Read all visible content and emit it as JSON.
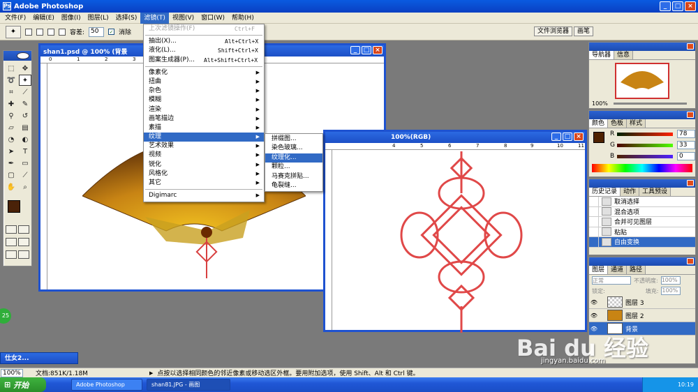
{
  "app": {
    "title": "Adobe Photoshop"
  },
  "menubar": [
    {
      "label": "文件(F)"
    },
    {
      "label": "编辑(E)"
    },
    {
      "label": "图像(I)"
    },
    {
      "label": "图层(L)"
    },
    {
      "label": "选择(S)"
    },
    {
      "label": "滤镜(T)"
    },
    {
      "label": "视图(V)"
    },
    {
      "label": "窗口(W)"
    },
    {
      "label": "帮助(H)"
    }
  ],
  "options": {
    "tolerance_label": "容差:",
    "tolerance_value": "50",
    "antialias_label": "消除"
  },
  "palette_well": [
    "文件浏览器",
    "画笔"
  ],
  "doc1": {
    "title": "shan1.psd @ 100% (背景",
    "ruler": [
      "0",
      "1",
      "2",
      "3",
      "4",
      "5"
    ]
  },
  "doc2": {
    "title": "100%(RGB)",
    "ruler": [
      "4",
      "5",
      "6",
      "7",
      "8",
      "9",
      "10",
      "11"
    ]
  },
  "filter_menu": {
    "last_filter": {
      "label": "上次滤镜操作(F)",
      "shortcut": "Ctrl+F"
    },
    "top": [
      {
        "label": "抽出(X)...",
        "shortcut": "Alt+Ctrl+X"
      },
      {
        "label": "液化(L)...",
        "shortcut": "Shift+Ctrl+X"
      },
      {
        "label": "图案生成器(P)...",
        "shortcut": "Alt+Shift+Ctrl+X"
      }
    ],
    "groups": [
      {
        "label": "像素化"
      },
      {
        "label": "扭曲"
      },
      {
        "label": "杂色"
      },
      {
        "label": "模糊"
      },
      {
        "label": "渲染"
      },
      {
        "label": "画笔描边"
      },
      {
        "label": "素描"
      },
      {
        "label": "纹理"
      },
      {
        "label": "艺术效果"
      },
      {
        "label": "视频"
      },
      {
        "label": "锐化"
      },
      {
        "label": "风格化"
      },
      {
        "label": "其它"
      }
    ],
    "digimarc": "Digimarc",
    "highlighted": "纹理"
  },
  "texture_submenu": [
    "拼缀图...",
    "染色玻璃...",
    "纹理化...",
    "颗粒...",
    "马赛克拼贴...",
    "龟裂缝..."
  ],
  "texture_highlighted": "纹理化...",
  "navigator": {
    "tabs": [
      "导航器",
      "信息"
    ],
    "zoom": "100%"
  },
  "color": {
    "tabs": [
      "颜色",
      "色板",
      "样式"
    ],
    "r": "78",
    "g": "33",
    "b": "0",
    "r_label": "R",
    "g_label": "G",
    "b_label": "B",
    "foreground": "#4e2100"
  },
  "history": {
    "tabs": [
      "历史记录",
      "动作",
      "工具预设"
    ],
    "items": [
      "取消选择",
      "混合选项",
      "合并可见图层",
      "粘贴",
      "自由变换"
    ]
  },
  "layers": {
    "tabs": [
      "图层",
      "通道",
      "路径"
    ],
    "mode": "正常",
    "opacity_label": "不透明度:",
    "opacity": "100%",
    "lock_label": "锁定:",
    "fill_label": "填充:",
    "fill": "100%",
    "items": [
      "图层 3",
      "图层 2",
      "背景"
    ]
  },
  "status": {
    "zoom": "100%",
    "doc": "文档:851K/1.18M",
    "hint": "点按以选择相同颜色的邻近像素或移动选区外框。要用附加选项，使用 Shift、Alt 和 Ctrl 键。"
  },
  "minimized": "仕女2...",
  "badge": "25",
  "taskbar": {
    "start": "开始",
    "tasks": [
      "Adobe Photoshop",
      "shan81.JPG - 画图"
    ],
    "time": "10:19"
  },
  "watermark": {
    "text": "Bai du 经验",
    "url": "jingyan.baidu.com"
  }
}
